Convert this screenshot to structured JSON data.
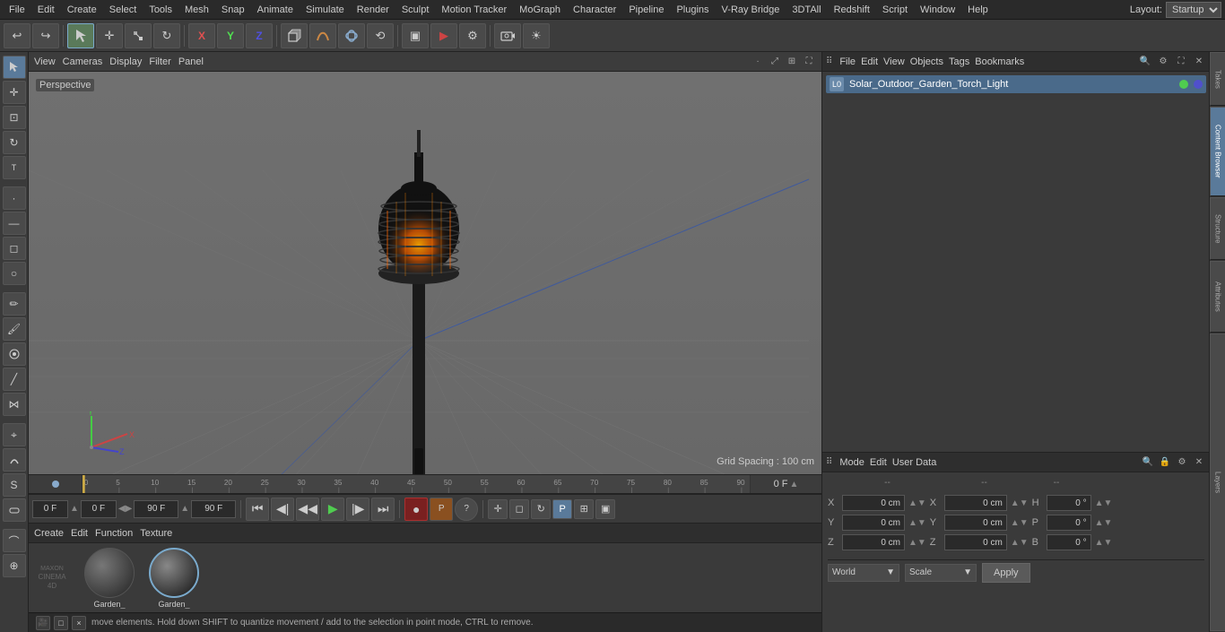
{
  "menubar": {
    "items": [
      "File",
      "Edit",
      "Create",
      "Select",
      "Tools",
      "Mesh",
      "Snap",
      "Animate",
      "Simulate",
      "Render",
      "Sculpt",
      "Motion Tracker",
      "MoGraph",
      "Character",
      "Pipeline",
      "Plugins",
      "V-Ray Bridge",
      "3DTAll",
      "Redshift",
      "Script",
      "Window",
      "Help"
    ],
    "layout_label": "Layout:",
    "layout_value": "Startup"
  },
  "toolbar": {
    "undo_icon": "↩",
    "redo_icon": "↪",
    "move_icon": "✛",
    "scale_icon": "⊕",
    "rotate_icon": "↻",
    "axis_x": "X",
    "axis_y": "Y",
    "axis_z": "Z"
  },
  "viewport": {
    "perspective_label": "Perspective",
    "view_menu": "View",
    "cameras_menu": "Cameras",
    "display_menu": "Display",
    "filter_menu": "Filter",
    "panel_menu": "Panel",
    "grid_spacing": "Grid Spacing : 100 cm"
  },
  "timeline": {
    "ticks": [
      0,
      5,
      10,
      15,
      20,
      25,
      30,
      35,
      40,
      45,
      50,
      55,
      60,
      65,
      70,
      75,
      80,
      85,
      90
    ],
    "start_frame": "0 F",
    "current_frame": "0 F",
    "end_frame": "90 F",
    "frame_display": "0 F"
  },
  "playback": {
    "current_frame_field": "0 F",
    "prev_frame_field": "0 F",
    "end_frame_field": "90 F",
    "end_frame2": "90 F"
  },
  "object_manager": {
    "menus": [
      "File",
      "Edit",
      "View",
      "Objects",
      "Tags",
      "Bookmarks"
    ],
    "object_name": "Solar_Outdoor_Garden_Torch_Light",
    "object_type": "L0"
  },
  "attributes": {
    "menus": [
      "Mode",
      "Edit",
      "User Data"
    ],
    "x_pos": "0 cm",
    "y_pos": "0 cm",
    "z_pos": "0 cm",
    "x_rot": "0 cm",
    "y_rot": "0 cm",
    "z_rot": "0 cm",
    "h_val": "0 °",
    "p_val": "0 °",
    "b_val": "0 °",
    "x_size": "0 cm",
    "y_size": "0 cm",
    "z_size": "0 cm",
    "col_labels": [
      "",
      "--",
      "--"
    ],
    "world_label": "World",
    "scale_label": "Scale",
    "apply_label": "Apply"
  },
  "materials": {
    "menus": [
      "Create",
      "Edit",
      "Function",
      "Texture"
    ],
    "items": [
      {
        "name": "Garden_",
        "selected": false
      },
      {
        "name": "Garden_",
        "selected": true
      }
    ]
  },
  "status_bar": {
    "text": "move elements. Hold down SHIFT to quantize movement / add to the selection in point mode, CTRL to remove."
  },
  "right_tabs": [
    "Takes",
    "Content Browser",
    "Structure",
    "Attributes",
    "Layers"
  ]
}
